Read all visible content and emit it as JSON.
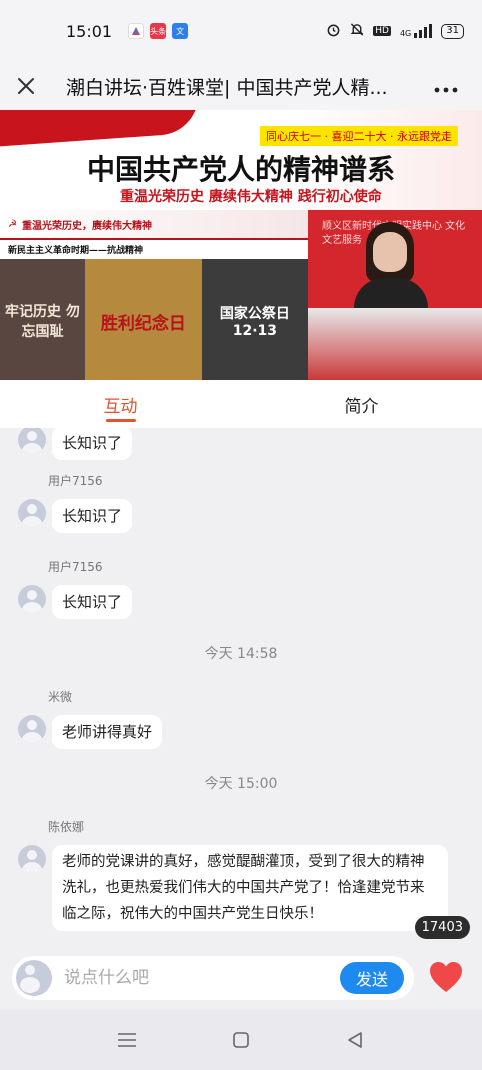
{
  "status_bar": {
    "time": "15:01",
    "apps": [
      {
        "name": "ali-app-icon",
        "label": "",
        "color": "#e63c3c"
      },
      {
        "name": "toutiao-icon",
        "label": "头条",
        "color": "#e8364a"
      },
      {
        "name": "translate-icon",
        "label": "文",
        "color": "#2d7ff0"
      }
    ],
    "network": "4G",
    "hd": "HD",
    "battery": "31"
  },
  "nav": {
    "title": "潮白讲坛·百姓课堂| 中国共产党人精..."
  },
  "video": {
    "slogan": "同心庆七一 · 喜迎二十大 · 永远跟党走",
    "title": "中国共产党人的精神谱系",
    "subtitle": "重温光荣历史  赓续伟大精神  践行初心使命",
    "banner": "重温光荣历史，赓续伟大精神",
    "era": "新民主主义革命时期——抗战精神",
    "panels": [
      "牢记历史 勿忘国耻",
      "胜利纪念日",
      "国家公祭日 12·13"
    ],
    "speaker_backdrop": "顺义区新时代文明实践中心 文化文艺服务"
  },
  "tabs": [
    {
      "label": "互动",
      "active": true
    },
    {
      "label": "简介",
      "active": false
    }
  ],
  "messages": [
    {
      "user": "",
      "text": "长知识了"
    },
    {
      "user": "用户7156",
      "text": "长知识了"
    },
    {
      "user": "用户7156",
      "text": "长知识了"
    },
    {
      "divider": "今天 14:58"
    },
    {
      "user": "米微",
      "text": "老师讲得真好"
    },
    {
      "divider": "今天 15:00"
    },
    {
      "user": "陈依娜",
      "text": "老师的党课讲的真好，感觉醍醐灌顶，受到了很大的精神洗礼，也更热爱我们伟大的中国共产党了！恰逢建党节来临之际，祝伟大的中国共产党生日快乐！"
    }
  ],
  "view_count": "17403",
  "input": {
    "placeholder": "说点什么吧",
    "send_label": "发送"
  },
  "colors": {
    "accent": "#e2542e",
    "send": "#1e8af0",
    "heart": "#f04848"
  }
}
